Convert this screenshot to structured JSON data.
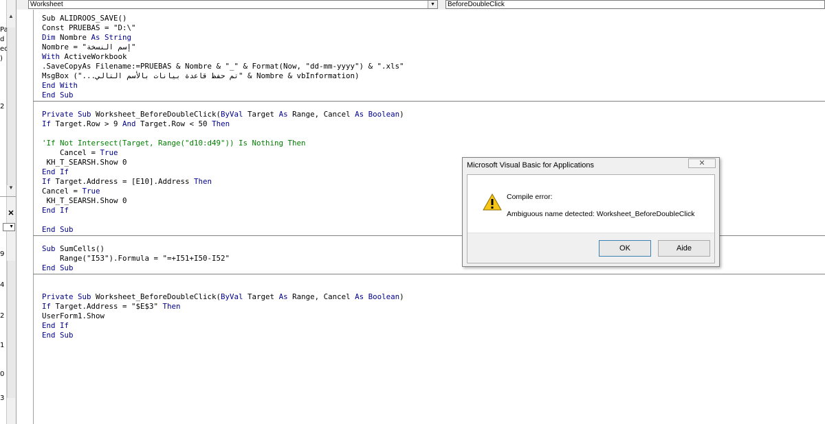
{
  "window": {
    "object_combo": "Worksheet",
    "procedure_combo": "BeforeDoubleClick",
    "dropdown_glyph": "▼"
  },
  "sidebar": {
    "fragments": [
      "Pa",
      "d",
      "ec",
      ")",
      "2"
    ],
    "close_glyph": "✕",
    "digits": [
      "9",
      "4",
      "2",
      "1",
      "0",
      "3"
    ]
  },
  "code": {
    "blocks": [
      [
        [
          {
            "t": "Sub ALIDROOS_SAVE()",
            "c": "normal"
          }
        ],
        [
          {
            "t": "Const PRUEBAS = \"D:\\\"",
            "c": "normal"
          }
        ],
        [
          {
            "t": "Dim",
            "c": "kw"
          },
          {
            "t": " Nombre ",
            "c": "normal"
          },
          {
            "t": "As String",
            "c": "kw"
          }
        ],
        [
          {
            "t": "Nombre = \"إسم النسخة\"",
            "c": "normal"
          }
        ],
        [
          {
            "t": "With",
            "c": "kw"
          },
          {
            "t": " ActiveWorkbook",
            "c": "normal"
          }
        ],
        [
          {
            "t": ".SaveCopyAs Filename:=PRUEBAS & Nombre & \"_\" & Format(Now, \"dd-mm-yyyy\") & \".xls\"",
            "c": "normal"
          }
        ],
        [
          {
            "t": "MsgBox (\"...تم حفظ قاعدة بيانات بالأسم التالي\" & Nombre & vbInformation)",
            "c": "normal"
          }
        ],
        [
          {
            "t": "End With",
            "c": "kw"
          }
        ],
        [
          {
            "t": "End Sub",
            "c": "kw"
          }
        ]
      ],
      [
        [
          {
            "t": "Private Sub",
            "c": "kw"
          },
          {
            "t": " Worksheet_BeforeDoubleClick(",
            "c": "normal"
          },
          {
            "t": "ByVal",
            "c": "kw"
          },
          {
            "t": " Target ",
            "c": "normal"
          },
          {
            "t": "As",
            "c": "kw"
          },
          {
            "t": " Range, Cancel ",
            "c": "normal"
          },
          {
            "t": "As Boolean",
            "c": "kw"
          },
          {
            "t": ")",
            "c": "normal"
          }
        ],
        [
          {
            "t": "If",
            "c": "kw"
          },
          {
            "t": " Target.Row > 9 ",
            "c": "normal"
          },
          {
            "t": "And",
            "c": "kw"
          },
          {
            "t": " Target.Row < 50 ",
            "c": "normal"
          },
          {
            "t": "Then",
            "c": "kw"
          }
        ],
        [
          {
            "t": "",
            "c": "normal"
          }
        ],
        [
          {
            "t": "'If Not Intersect(Target, Range(\"d10:d49\")) Is Nothing Then",
            "c": "cm"
          }
        ],
        [
          {
            "t": "    Cancel = ",
            "c": "normal"
          },
          {
            "t": "True",
            "c": "kw"
          }
        ],
        [
          {
            "t": " KH_T_SEARSH.Show 0",
            "c": "normal"
          }
        ],
        [
          {
            "t": "End If",
            "c": "kw"
          }
        ],
        [
          {
            "t": "If",
            "c": "kw"
          },
          {
            "t": " Target.Address = [E10].Address ",
            "c": "normal"
          },
          {
            "t": "Then",
            "c": "kw"
          }
        ],
        [
          {
            "t": "Cancel = ",
            "c": "normal"
          },
          {
            "t": "True",
            "c": "kw"
          }
        ],
        [
          {
            "t": " KH_T_SEARSH.Show 0",
            "c": "normal"
          }
        ],
        [
          {
            "t": "End If",
            "c": "kw"
          }
        ],
        [
          {
            "t": "",
            "c": "normal"
          }
        ],
        [
          {
            "t": "End Sub",
            "c": "kw"
          }
        ]
      ],
      [
        [
          {
            "t": "",
            "c": "normal"
          }
        ],
        [
          {
            "t": "Sub",
            "c": "kw"
          },
          {
            "t": " SumCells()",
            "c": "normal"
          }
        ],
        [
          {
            "t": "    Range(\"I53\").Formula = \"=+I51+I50-I52\"",
            "c": "normal"
          }
        ],
        [
          {
            "t": "End Sub",
            "c": "kw"
          }
        ]
      ],
      [
        [
          {
            "t": "",
            "c": "normal"
          }
        ],
        [
          {
            "t": "Private Sub",
            "c": "kw"
          },
          {
            "t": " Worksheet_BeforeDoubleClick(",
            "c": "normal"
          },
          {
            "t": "ByVal",
            "c": "kw"
          },
          {
            "t": " Target ",
            "c": "normal"
          },
          {
            "t": "As",
            "c": "kw"
          },
          {
            "t": " Range, Cancel ",
            "c": "normal"
          },
          {
            "t": "As Boolean",
            "c": "kw"
          },
          {
            "t": ")",
            "c": "normal"
          }
        ],
        [
          {
            "t": "If",
            "c": "kw"
          },
          {
            "t": " Target.Address = \"$E$3\" ",
            "c": "normal"
          },
          {
            "t": "Then",
            "c": "kw"
          }
        ],
        [
          {
            "t": "UserForm1.Show",
            "c": "normal"
          }
        ],
        [
          {
            "t": "End If",
            "c": "kw"
          }
        ],
        [
          {
            "t": "End Sub",
            "c": "kw"
          }
        ]
      ]
    ]
  },
  "dialog": {
    "title": "Microsoft Visual Basic for Applications",
    "close_glyph": "✕",
    "error_title": "Compile error:",
    "message": "Ambiguous name detected: Worksheet_BeforeDoubleClick",
    "ok_label": "OK",
    "help_label": "Aide",
    "icon": "warning-icon"
  },
  "colors": {
    "keyword": "#00008b",
    "comment": "#008000",
    "text": "#000000"
  }
}
